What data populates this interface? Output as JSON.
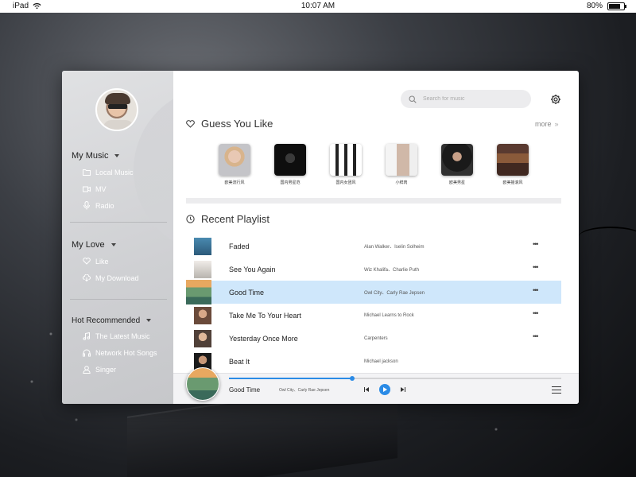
{
  "statusbar": {
    "device": "iPad",
    "time": "10:07 AM",
    "battery_text": "80%",
    "battery_level": 0.8
  },
  "sidebar": {
    "sections": [
      {
        "title": "My Music",
        "items": [
          {
            "label": "Local Music",
            "icon": "folder-icon"
          },
          {
            "label": "MV",
            "icon": "video-camera-icon"
          },
          {
            "label": "Radio",
            "icon": "microphone-icon"
          }
        ]
      },
      {
        "title": "My Love",
        "items": [
          {
            "label": "Like",
            "icon": "heart-icon"
          },
          {
            "label": "My Download",
            "icon": "cloud-download-icon"
          }
        ]
      },
      {
        "title": "Hot Recommended",
        "items": [
          {
            "label": "The Latest Music",
            "icon": "music-note-icon"
          },
          {
            "label": "Network Hot Songs",
            "icon": "headphones-icon"
          },
          {
            "label": "Singer",
            "icon": "user-icon"
          }
        ]
      }
    ]
  },
  "search": {
    "placeholder": "Search for music"
  },
  "guess": {
    "title": "Guess You Like",
    "more_label": "more",
    "more_arrow": "»",
    "items": [
      {
        "label": "欧美流行风"
      },
      {
        "label": "国内男星范"
      },
      {
        "label": "国内女团风"
      },
      {
        "label": "小鲜肉"
      },
      {
        "label": "欧美男星"
      },
      {
        "label": "欧美摇滚风"
      }
    ]
  },
  "recent": {
    "title": "Recent Playlist",
    "more_glyph": "•••",
    "tracks": [
      {
        "title": "Faded",
        "artist": "Alan Walker、Iselin Solheim"
      },
      {
        "title": "See You Again",
        "artist": "Wiz Khalifa、Charlie Puth"
      },
      {
        "title": "Good Time",
        "artist": "Owl City、Carly Rae Jepsen",
        "active": true
      },
      {
        "title": "Take Me To Your Heart",
        "artist": "Michael Learns to Rock"
      },
      {
        "title": "Yesterday Once More",
        "artist": "Carpenters"
      },
      {
        "title": "Beat It",
        "artist": "Michael jackson"
      }
    ]
  },
  "player": {
    "title": "Good Time",
    "artist": "Owl City、Carly Rae Jepsen",
    "progress": 0.37
  },
  "colors": {
    "accent": "#2b8be6",
    "active_row": "#cfe7fb"
  }
}
